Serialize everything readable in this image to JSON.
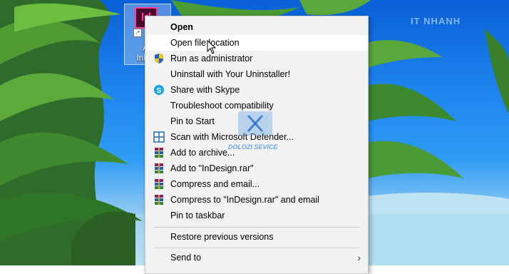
{
  "desktop": {
    "shortcut": {
      "label_line1": "Ac",
      "label_line2": "InDes",
      "icon_letters": "Id"
    },
    "watermark_logo": "IT NHANH"
  },
  "context_menu": {
    "items": [
      {
        "label": "Open",
        "bold": true,
        "icon": ""
      },
      {
        "label": "Open file location",
        "icon": "",
        "hover": true
      },
      {
        "label": "Run as administrator",
        "icon": "uac-shield-icon"
      },
      {
        "label": "Uninstall with Your Uninstaller!",
        "icon": ""
      },
      {
        "label": "Share with Skype",
        "icon": "skype-icon"
      },
      {
        "label": "Troubleshoot compatibility",
        "icon": ""
      },
      {
        "label": "Pin to Start",
        "icon": ""
      },
      {
        "label": "Scan with Microsoft Defender...",
        "icon": "defender-icon"
      },
      {
        "label": "Add to archive...",
        "icon": "winrar-icon"
      },
      {
        "label": "Add to \"InDesign.rar\"",
        "icon": "winrar-icon"
      },
      {
        "label": "Compress and email...",
        "icon": "winrar-icon"
      },
      {
        "label": "Compress to \"InDesign.rar\" and email",
        "icon": "winrar-icon"
      },
      {
        "label": "Pin to taskbar",
        "icon": ""
      },
      {
        "label": "Restore previous versions",
        "icon": ""
      },
      {
        "label": "Send to",
        "icon": "",
        "submenu": true
      }
    ]
  },
  "overlay_watermark": {
    "text": "DOLOZI SEVICE"
  },
  "colors": {
    "menu_bg": "#f2f2f2",
    "hover_bg": "#ffffff",
    "indesign_pink": "#ff3d9a"
  }
}
